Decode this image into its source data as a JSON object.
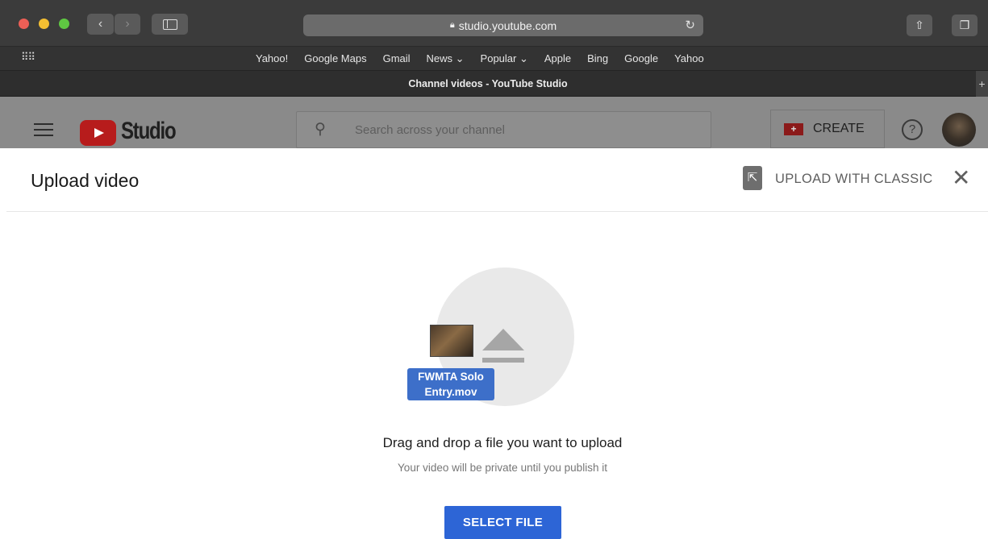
{
  "browser": {
    "url": "studio.youtube.com",
    "lock_icon": "lock-icon",
    "reload_icon": "reload-icon",
    "share_icon": "share-icon",
    "tabs_icon": "tabs-overview-icon",
    "tab_title": "Channel videos - YouTube Studio",
    "new_tab_symbol": "+",
    "traffic_colors": [
      "#ec5f56",
      "#f4bf32",
      "#5fc842"
    ],
    "bookmarks": [
      "Yahoo!",
      "Google Maps",
      "Gmail",
      "News ⌄",
      "Popular ⌄",
      "Apple",
      "Bing",
      "Google",
      "Yahoo"
    ]
  },
  "studio": {
    "logo_text": "Studio",
    "search_placeholder": "Search across your channel",
    "create_label": "CREATE",
    "help_symbol": "?"
  },
  "dialog": {
    "title": "Upload video",
    "classic_label": "UPLOAD WITH CLASSIC",
    "close_symbol": "✕",
    "dragged_file": "FWMTA Solo Entry.mov",
    "drag_text": "Drag and drop a file you want to upload",
    "private_text": "Your video will be private until you publish it",
    "select_label": "SELECT FILE"
  }
}
